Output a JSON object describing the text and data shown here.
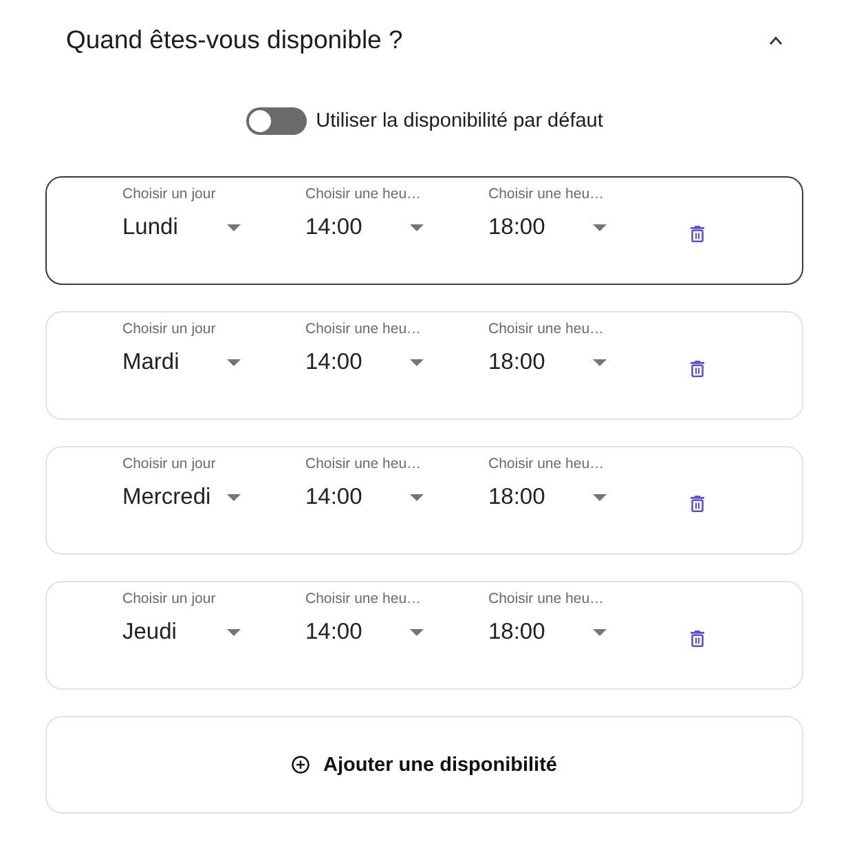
{
  "section": {
    "title": "Quand êtes-vous disponible ?",
    "expanded": true
  },
  "default_toggle": {
    "label": "Utiliser la disponibilité par défaut",
    "on": false
  },
  "slots": [
    {
      "selected": true,
      "day": {
        "label": "Choisir un jour",
        "value": "Lundi"
      },
      "start": {
        "label": "Choisir une heu…",
        "value": "14:00"
      },
      "end": {
        "label": "Choisir une heu…",
        "value": "18:00"
      }
    },
    {
      "selected": false,
      "day": {
        "label": "Choisir un jour",
        "value": "Mardi"
      },
      "start": {
        "label": "Choisir une heu…",
        "value": "14:00"
      },
      "end": {
        "label": "Choisir une heu…",
        "value": "18:00"
      }
    },
    {
      "selected": false,
      "day": {
        "label": "Choisir un jour",
        "value": "Mercredi"
      },
      "start": {
        "label": "Choisir une heu…",
        "value": "14:00"
      },
      "end": {
        "label": "Choisir une heu…",
        "value": "18:00"
      }
    },
    {
      "selected": false,
      "day": {
        "label": "Choisir un jour",
        "value": "Jeudi"
      },
      "start": {
        "label": "Choisir une heu…",
        "value": "14:00"
      },
      "end": {
        "label": "Choisir une heu…",
        "value": "18:00"
      }
    }
  ],
  "add_button": {
    "label": "Ajouter une disponibilité"
  }
}
